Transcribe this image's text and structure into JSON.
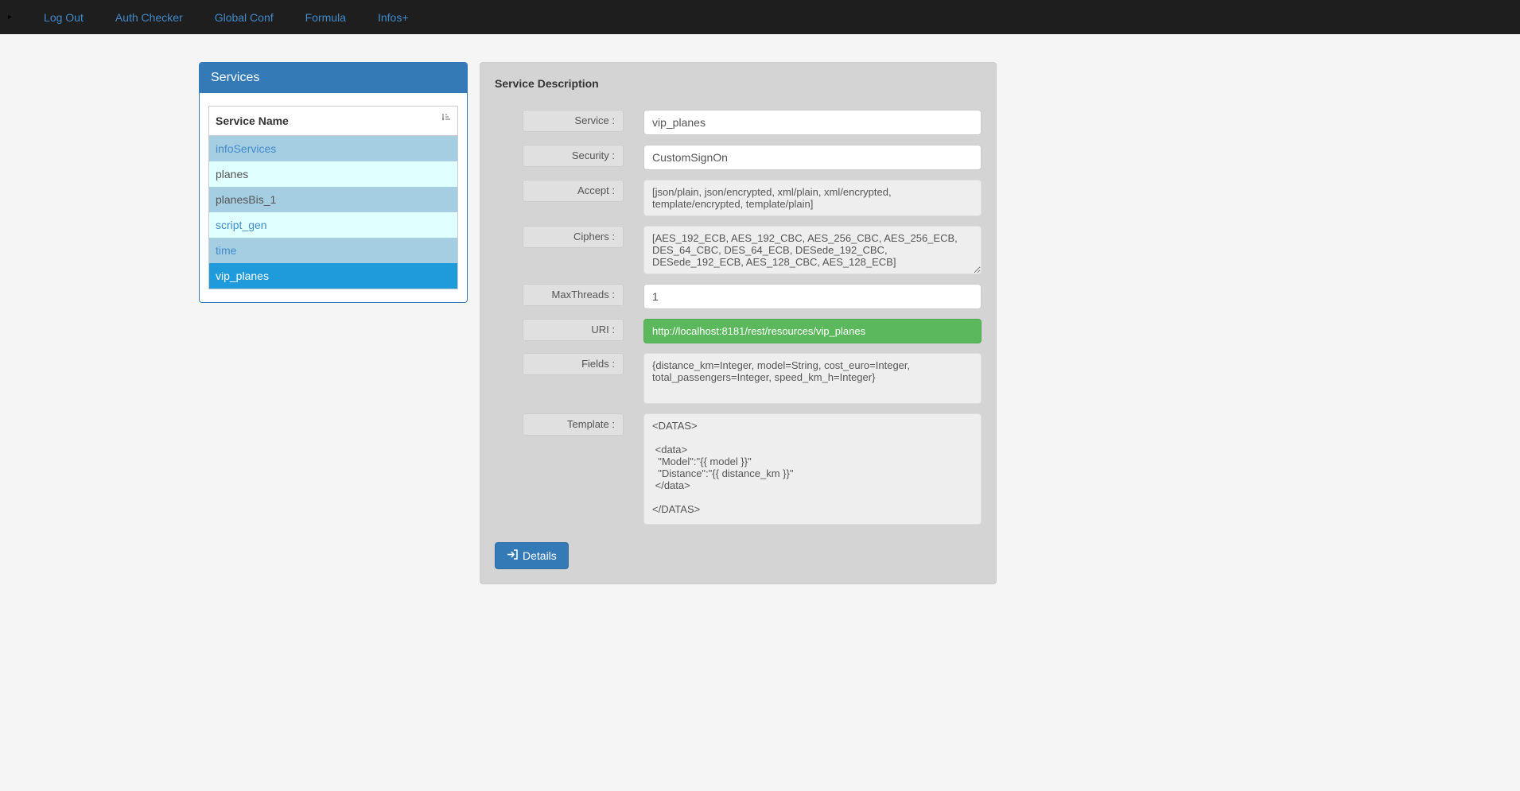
{
  "nav": {
    "logout": "Log Out",
    "auth": "Auth Checker",
    "conf": "Global Conf",
    "formula": "Formula",
    "infos": "Infos+"
  },
  "sidebar": {
    "title": "Services",
    "col_header": "Service Name",
    "rows": {
      "r0": "infoServices",
      "r1": "planes",
      "r2": "planesBis_1",
      "r3": "script_gen",
      "r4": "time",
      "r5": "vip_planes"
    }
  },
  "details": {
    "heading": "Service Description",
    "labels": {
      "service": "Service :",
      "security": "Security :",
      "accept": "Accept :",
      "ciphers": "Ciphers :",
      "maxthreads": "MaxThreads :",
      "uri": "URI :",
      "fields": "Fields :",
      "template": "Template :"
    },
    "values": {
      "service": "vip_planes",
      "security": "CustomSignOn",
      "accept": "[json/plain, json/encrypted, xml/plain, xml/encrypted, template/encrypted, template/plain]",
      "ciphers": "[AES_192_ECB, AES_192_CBC, AES_256_CBC, AES_256_ECB, DES_64_CBC, DES_64_ECB, DESede_192_CBC, DESede_192_ECB, AES_128_CBC, AES_128_ECB]",
      "maxthreads": "1",
      "uri": "http://localhost:8181/rest/resources/vip_planes",
      "fields": "{distance_km=Integer, model=String, cost_euro=Integer, total_passengers=Integer, speed_km_h=Integer}",
      "template": "<DATAS>\n\n <data>\n  \"Model\":\"{{ model }}\"\n  \"Distance\":\"{{ distance_km }}\"\n </data>\n\n</DATAS>"
    },
    "button": "Details"
  }
}
